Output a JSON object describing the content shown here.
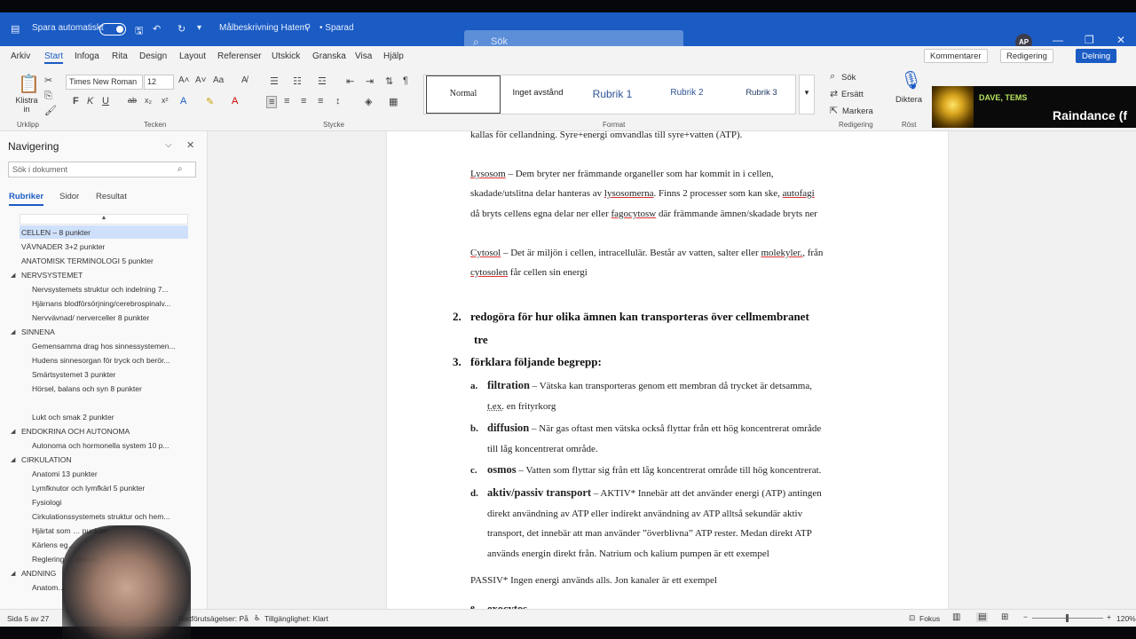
{
  "titlebar": {
    "autosave_label": "Spara automatiskt",
    "doc_title": "Målbeskrivning Hatem",
    "saved_status": "• Sparad",
    "search_placeholder": "Sök",
    "avatar_initials": "AP"
  },
  "menu": [
    "Arkiv",
    "Start",
    "Infoga",
    "Rita",
    "Design",
    "Layout",
    "Referenser",
    "Utskick",
    "Granska",
    "Visa",
    "Hjälp"
  ],
  "top_buttons": {
    "comments": "Kommentarer",
    "editing": "Redigering",
    "share": "Delning"
  },
  "ribbon": {
    "paste_label": "Klistra in",
    "font_name": "Times New Roman",
    "font_size": "12",
    "styles": [
      "Normal",
      "Inget avstånd",
      "Rubrik 1",
      "Rubrik 2",
      "Rubrik 3"
    ],
    "find_label": "Sök",
    "replace_label": "Ersätt",
    "select_label": "Markera",
    "dictate_label": "Diktera",
    "groups": {
      "clipboard": "Urklipp",
      "font": "Tecken",
      "paragraph": "Stycke",
      "styles": "Format",
      "editing": "Redigering",
      "voice": "Röst"
    }
  },
  "overlay": {
    "names": "DAVE, TEMS",
    "song": "Raindance (f"
  },
  "nav": {
    "title": "Navigering",
    "search_placeholder": "Sök i dokument",
    "tabs": [
      "Rubriker",
      "Sidor",
      "Resultat"
    ],
    "items": [
      {
        "label": "CELLEN – 8 punkter",
        "level": 1,
        "selected": true
      },
      {
        "label": "VÄVNADER 3+2 punkter",
        "level": 1
      },
      {
        "label": "ANATOMISK TERMINOLOGI 5 punkter",
        "level": 1
      },
      {
        "label": "NERVSYSTEMET",
        "level": 1,
        "caret": true
      },
      {
        "label": "Nervsystemets struktur och indelning 7...",
        "level": 2
      },
      {
        "label": "Hjärnans blodförsörjning/cerebrospinalv...",
        "level": 2
      },
      {
        "label": "Nervvävnad/ nerverceller 8 punkter",
        "level": 2
      },
      {
        "label": "SINNENA",
        "level": 1,
        "caret": true
      },
      {
        "label": "Gemensamma drag hos sinnessystemen...",
        "level": 2
      },
      {
        "label": "Hudens sinnesorgan för tryck och berör...",
        "level": 2
      },
      {
        "label": "Smärtsystemet 3 punkter",
        "level": 2
      },
      {
        "label": "Hörsel, balans och syn 8 punkter",
        "level": 2
      },
      {
        "label": "",
        "level": 2
      },
      {
        "label": "Lukt och smak 2 punkter",
        "level": 2
      },
      {
        "label": "ENDOKRINA OCH AUTONOMA",
        "level": 1,
        "caret": true
      },
      {
        "label": "Autonoma och hormonella system 10 p...",
        "level": 2
      },
      {
        "label": "CIRKULATION",
        "level": 1,
        "caret": true
      },
      {
        "label": "Anatomi 13 punkter",
        "level": 2
      },
      {
        "label": "Lymfknutor och lymfkärl 5 punkter",
        "level": 2
      },
      {
        "label": "Fysiologi",
        "level": 2
      },
      {
        "label": "Cirkulationssystemets struktur och hem...",
        "level": 2
      },
      {
        "label": "Hjärtat som … punkter",
        "level": 2
      },
      {
        "label": "Kärlens eg…",
        "level": 2
      },
      {
        "label": "Reglering … cirkula...",
        "level": 2
      },
      {
        "label": "ANDNING",
        "level": 1,
        "caret": true
      },
      {
        "label": "Anatom…",
        "level": 2
      }
    ]
  },
  "doc": {
    "p1": "kallas för cellandning. Syre+energi omvandlas till syre+vatten (ATP).",
    "lysosom_term": "Lysosom",
    "lysosom_l1_rest": " – Dem bryter ner främmande organeller som har kommit in i cellen,",
    "lysosom_l2a": "skadade/utslitna delar hanteras av ",
    "lysosom_l2_term": "lysosomerna",
    "lysosom_l2b": ". Finns 2 processer som kan ske, ",
    "lysosom_l2_term2": "autofagi",
    "lysosom_l3a": "då bryts cellens egna delar ner eller ",
    "lysosom_l3_term": "fagocytosw",
    "lysosom_l3b": " där främmande ämnen/skadade bryts ner",
    "cytosol_term": "Cytosol",
    "cytosol_l1a": " – Det är miljön i cellen, intracellulär. Består av vatten, salter eller ",
    "cytosol_l1_term": "molekyler.",
    "cytosol_l1b": ", från",
    "cytosol_l2_term": "cytosolen",
    "cytosol_l2b": " får cellen sin energi",
    "h2_num": "2.",
    "h2_text": "redogöra för hur olika ämnen kan transporteras över cellmembranet",
    "h2_cont": "tre",
    "h3_num": "3.",
    "h3_text": "förklara följande begrepp:",
    "a_label": "a.",
    "a_term": "filtration",
    "a_text": " – Vätska kan transporteras genom ett membran då trycket är detsamma,",
    "a_cont_term": "t.ex.",
    "a_cont": " en frityrkorg",
    "b_label": "b.",
    "b_term": "diffusion",
    "b_text": " – När gas oftast men vätska också flyttar från ett hög koncentrerat område",
    "b_cont": "till låg koncentrerat område.",
    "c_label": "c.",
    "c_term": "osmos",
    "c_text": " – Vatten som flyttar sig från ett låg koncentrerat område till hög koncentrerat.",
    "d_label": "d.",
    "d_term": "aktiv/passiv transport",
    "d_text": " – AKTIV* Innebär att det använder energi (ATP) antingen",
    "d_l2": "direkt användning av ATP eller indirekt användning av ATP alltså sekundär aktiv",
    "d_l3": "transport, det innebär att man använder ”överblivna” ATP rester. Medan direkt ATP",
    "d_l4": "används energin direkt från. Natrium och kalium pumpen är ett exempel",
    "passiv": "PASSIV* Ingen energi används alls. Jon kanaler är ett exempel",
    "e_label": "e.",
    "e_term": "exocytos"
  },
  "status": {
    "page": "Sida 5 av 27",
    "predictions": "Textförutsägelser: På",
    "accessibility": "Tillgänglighet: Klart",
    "focus": "Fokus",
    "zoom": "120%"
  }
}
